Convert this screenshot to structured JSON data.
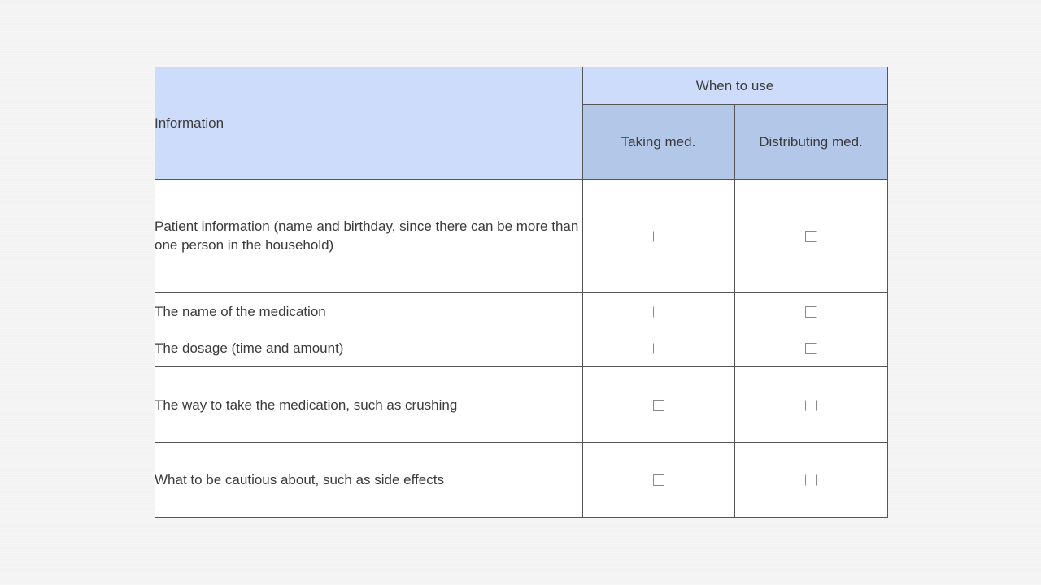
{
  "table": {
    "header": {
      "information": "Information",
      "when_to_use": "When to use",
      "taking": "Taking med.",
      "distributing": "Distributing med."
    },
    "rows": [
      {
        "info": "Patient information (name and birthday, since there can be more than one person in the household)",
        "taking_checked": false,
        "distributing_checked": false
      },
      {
        "info": "The name of the medication",
        "taking_checked": false,
        "distributing_checked": false
      },
      {
        "info": "The dosage (time and amount)",
        "taking_checked": false,
        "distributing_checked": false
      },
      {
        "info": "The way to take the medication, such as crushing",
        "taking_checked": false,
        "distributing_checked": false
      },
      {
        "info": "What to be cautious about, such as side effects",
        "taking_checked": false,
        "distributing_checked": false
      }
    ]
  },
  "colors": {
    "header_light": "#cddcfb",
    "header_dark": "#b3c7e8",
    "border": "#555555"
  }
}
